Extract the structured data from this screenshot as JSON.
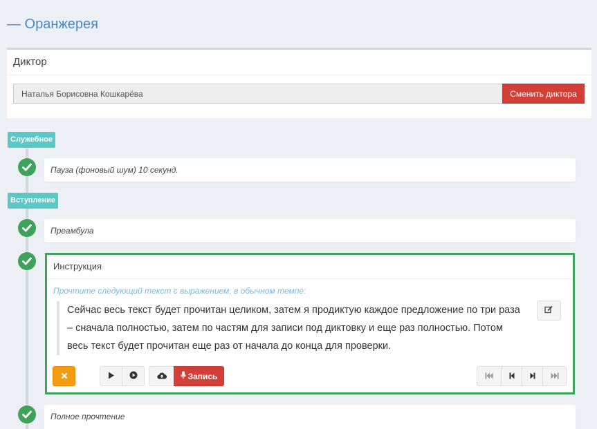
{
  "page_title": "— Оранжерея",
  "dictor": {
    "heading": "Диктор",
    "name": "Наталья Борисовна Кошкарёва",
    "change_button": "Сменить диктора"
  },
  "sections": [
    {
      "label": "Служебное",
      "items": [
        {
          "title": "Пауза (фоновый шум) 10 секунд.",
          "status": "done"
        }
      ]
    },
    {
      "label": "Вступление",
      "items": [
        {
          "title": "Преамбула",
          "status": "done"
        },
        {
          "title": "Инструкция",
          "status": "done",
          "active": true
        },
        {
          "title": "Полное прочтение",
          "status": "done"
        }
      ]
    }
  ],
  "active_item": {
    "heading": "Инструкция",
    "hint": "Прочтите следующий текст с выражением, в обычном темпе:",
    "text": "Сейчас весь текст будет прочитан целиком, затем я продиктую каждое предложение по три раза – сначала полностью, затем по частям для записи под диктовку и еще раз полностью. Потом весь текст будет прочитан еще раз от начала до конца для проверки.",
    "record_button": "Запись"
  },
  "icons": {
    "check": "check-icon",
    "edit": "edit-icon",
    "cancel": "times-icon",
    "play": "play-icon",
    "play_circle": "play-circle-icon",
    "upload": "cloud-upload-icon",
    "mic": "microphone-icon",
    "first": "fast-backward-icon",
    "prev": "step-backward-icon",
    "next": "step-forward-icon",
    "last": "fast-forward-icon"
  },
  "colors": {
    "accent_title": "#4a8ac4",
    "section_label": "#5bc8c5",
    "check": "#3ea25a",
    "danger": "#d13f37",
    "warning": "#f39c12",
    "hint": "#7ab7dc"
  }
}
